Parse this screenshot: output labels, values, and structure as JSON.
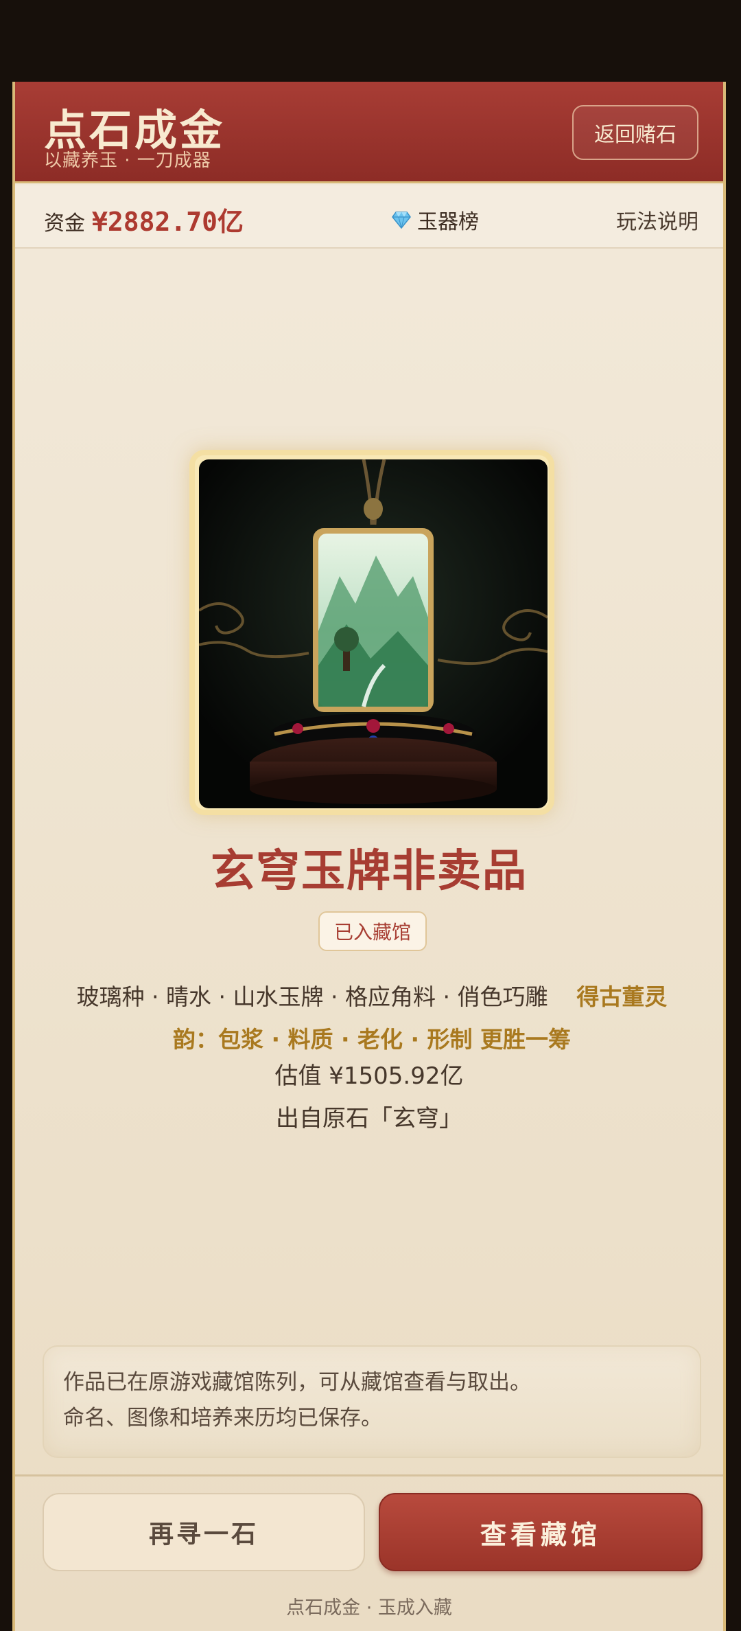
{
  "header": {
    "title": "点石成金",
    "subtitle": "以藏养玉 · 一刀成器",
    "back_label": "返回赌石"
  },
  "status": {
    "funds_label": "资金",
    "funds_value": "¥2882.70亿",
    "rank_label": "玉器榜",
    "rank_icon": "gem-icon",
    "rules_label": "玩法说明"
  },
  "item": {
    "image_icon": "jade-pendant-image",
    "title": "玄穹玉牌非卖品",
    "badge": "已入藏馆",
    "traits": "玻璃种 · 晴水 · 山水玉牌 · 格应角料 · 俏色巧雕",
    "bonus": "得古董灵韵：包浆 · 料质 · 老化 · 形制 更胜一筹",
    "valuation": "估值 ¥1505.92亿",
    "origin": "出自原石「玄穹」"
  },
  "note": {
    "line1": "作品已在原游戏藏馆陈列，可从藏馆查看与取出。",
    "line2": "命名、图像和培养来历均已保存。"
  },
  "actions": {
    "again_label": "再寻一石",
    "view_label": "查看藏馆"
  },
  "footer": "点石成金 · 玉成入藏",
  "colors": {
    "accent_red": "#a83d35",
    "gold": "#d8b978",
    "bonus_gold": "#a9791f"
  }
}
